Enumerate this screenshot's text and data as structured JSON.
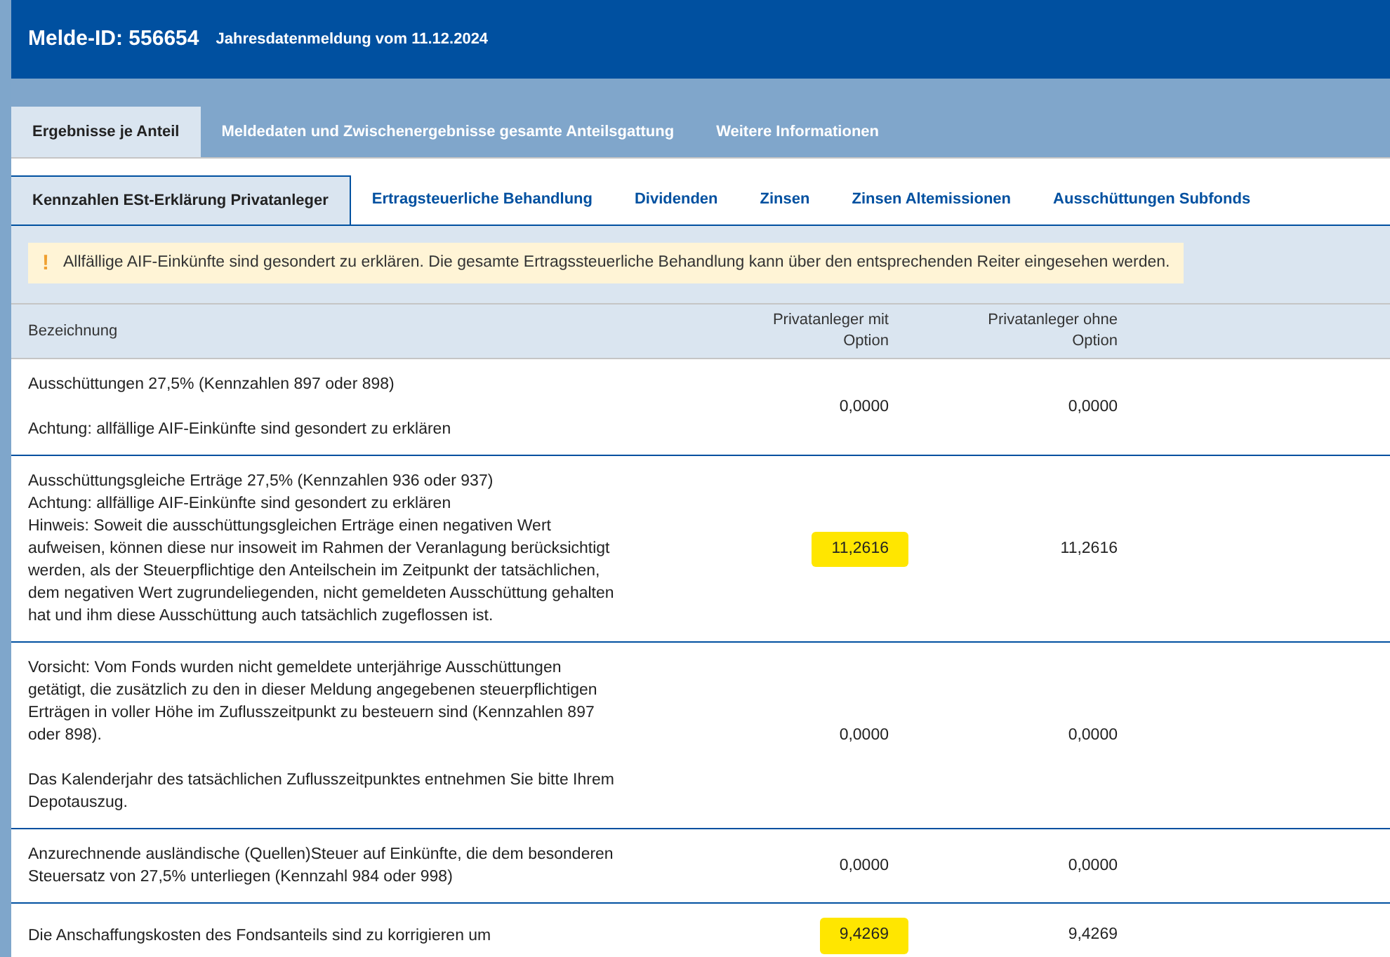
{
  "header": {
    "id_label": "Melde-ID: 556654",
    "subtitle": "Jahresdatenmeldung vom 11.12.2024"
  },
  "main_tabs": [
    {
      "label": "Ergebnisse je Anteil",
      "selected": true
    },
    {
      "label": "Meldedaten und Zwischenergebnisse gesamte Anteilsgattung",
      "selected": false
    },
    {
      "label": "Weitere Informationen",
      "selected": false
    }
  ],
  "sub_tabs": [
    {
      "label": "Kennzahlen ESt-Erklärung Privatanleger",
      "selected": true
    },
    {
      "label": "Ertragsteuerliche Behandlung",
      "selected": false
    },
    {
      "label": "Dividenden",
      "selected": false
    },
    {
      "label": "Zinsen",
      "selected": false
    },
    {
      "label": "Zinsen Altemissionen",
      "selected": false
    },
    {
      "label": "Ausschüttungen Subfonds",
      "selected": false
    }
  ],
  "alert": {
    "icon": "!",
    "text": "Allfällige AIF-Einkünfte sind gesondert zu erklären. Die gesamte Ertragssteuerliche Behandlung kann über den entsprechenden Reiter eingesehen werden."
  },
  "table": {
    "columns": [
      "Bezeichnung",
      "Privatanleger mit Option",
      "Privatanleger ohne Option"
    ],
    "rows": [
      {
        "paragraphs": [
          [
            "Ausschüttungen 27,5% (Kennzahlen 897 oder 898)"
          ],
          [
            "Achtung: allfällige AIF-Einkünfte sind gesondert zu erklären"
          ]
        ],
        "values": [
          {
            "text": "0,0000",
            "highlighted": false
          },
          {
            "text": "0,0000",
            "highlighted": false
          }
        ]
      },
      {
        "paragraphs": [
          [
            "Ausschüttungsgleiche Erträge 27,5% (Kennzahlen 936 oder 937)",
            "Achtung: allfällige AIF-Einkünfte sind gesondert zu erklären",
            "Hinweis: Soweit die ausschüttungsgleichen Erträge einen negativen Wert aufweisen, können diese nur insoweit im Rahmen der Veranlagung berücksichtigt werden, als der Steuerpflichtige den Anteilschein im Zeitpunkt der tatsächlichen, dem negativen Wert zugrundeliegenden, nicht gemeldeten Ausschüttung gehalten hat und ihm diese Ausschüttung auch tatsächlich zugeflossen ist."
          ]
        ],
        "values": [
          {
            "text": "11,2616",
            "highlighted": true
          },
          {
            "text": "11,2616",
            "highlighted": false
          }
        ]
      },
      {
        "paragraphs": [
          [
            "Vorsicht: Vom Fonds wurden nicht gemeldete unterjährige Ausschüttungen getätigt, die zusätzlich zu den in dieser Meldung angegebenen steuerpflichtigen Erträgen in voller Höhe im Zuflusszeitpunkt zu besteuern sind (Kennzahlen 897 oder 898)."
          ],
          [
            "Das Kalenderjahr des tatsächlichen Zuflusszeitpunktes entnehmen Sie bitte Ihrem Depotauszug."
          ]
        ],
        "values": [
          {
            "text": "0,0000",
            "highlighted": false
          },
          {
            "text": "0,0000",
            "highlighted": false
          }
        ]
      },
      {
        "paragraphs": [
          [
            "Anzurechnende ausländische (Quellen)Steuer auf Einkünfte, die dem besonderen Steuersatz von 27,5% unterliegen (Kennzahl 984 oder 998)"
          ]
        ],
        "values": [
          {
            "text": "0,0000",
            "highlighted": false
          },
          {
            "text": "0,0000",
            "highlighted": false
          }
        ]
      },
      {
        "paragraphs": [
          [
            "Die Anschaffungskosten des Fondsanteils sind zu korrigieren um"
          ]
        ],
        "values": [
          {
            "text": "9,4269",
            "highlighted": true
          },
          {
            "text": "9,4269",
            "highlighted": false
          }
        ]
      }
    ]
  }
}
